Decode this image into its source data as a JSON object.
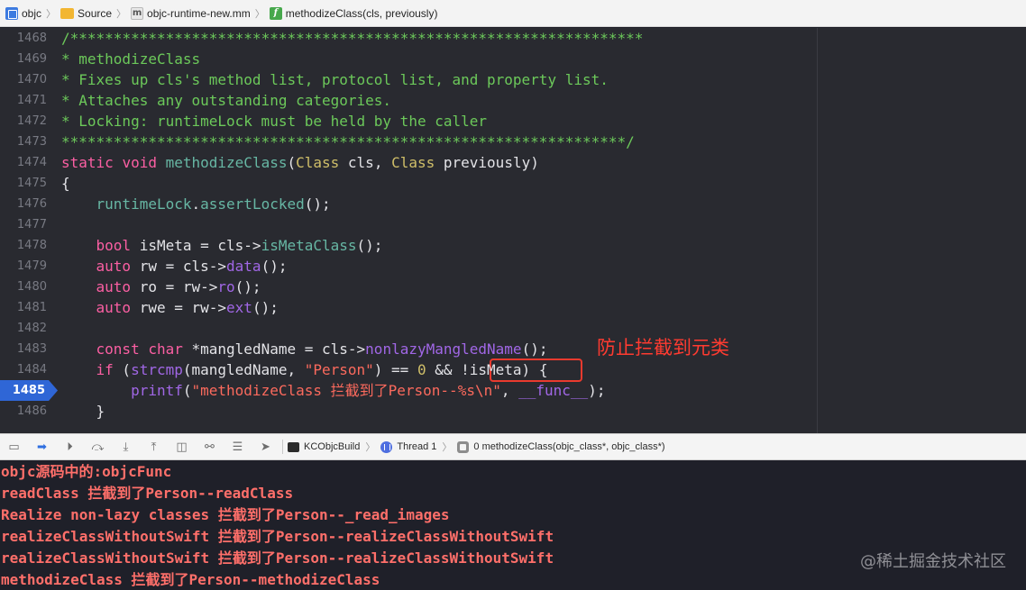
{
  "breadcrumb": [
    {
      "label": "objc",
      "icon": "project-icon"
    },
    {
      "label": "Source",
      "icon": "folder-icon"
    },
    {
      "label": "objc-runtime-new.mm",
      "icon": "objc-file-icon"
    },
    {
      "label": "methodizeClass(cls, previously)",
      "icon": "function-icon"
    }
  ],
  "editor": {
    "current_line": "1485",
    "annotation": "防止拦截到元类",
    "line_numbers": [
      "1468",
      "1469",
      "1470",
      "1471",
      "1472",
      "1473",
      "1474",
      "1475",
      "1476",
      "1477",
      "1478",
      "1479",
      "1480",
      "1481",
      "1482",
      "1483",
      "1484",
      "1485",
      "1486"
    ],
    "lines": [
      [
        {
          "t": "/**",
          "c": "com"
        },
        {
          "t": "****************************************************************",
          "c": "com"
        }
      ],
      [
        {
          "t": "* methodizeClass",
          "c": "com"
        }
      ],
      [
        {
          "t": "* Fixes up cls's method list, protocol list, and property list.",
          "c": "com"
        }
      ],
      [
        {
          "t": "* Attaches any outstanding categories.",
          "c": "com"
        }
      ],
      [
        {
          "t": "* Locking: runtimeLock must be held by the caller",
          "c": "com"
        }
      ],
      [
        {
          "t": "*****************************************************************/",
          "c": "com"
        }
      ],
      [
        {
          "t": "static",
          "c": "kw"
        },
        {
          "t": " ",
          "c": "txt"
        },
        {
          "t": "void",
          "c": "kw"
        },
        {
          "t": " ",
          "c": "txt"
        },
        {
          "t": "methodizeClass",
          "c": "fn"
        },
        {
          "t": "(",
          "c": "txt"
        },
        {
          "t": "Class",
          "c": "num"
        },
        {
          "t": " cls, ",
          "c": "txt"
        },
        {
          "t": "Class",
          "c": "num"
        },
        {
          "t": " previously)",
          "c": "txt"
        }
      ],
      [
        {
          "t": "{",
          "c": "txt"
        }
      ],
      [
        {
          "t": "    ",
          "c": "txt"
        },
        {
          "t": "runtimeLock",
          "c": "fn"
        },
        {
          "t": ".",
          "c": "txt"
        },
        {
          "t": "assertLocked",
          "c": "fn"
        },
        {
          "t": "();",
          "c": "txt"
        }
      ],
      [
        {
          "t": "",
          "c": "txt"
        }
      ],
      [
        {
          "t": "    ",
          "c": "txt"
        },
        {
          "t": "bool",
          "c": "kw"
        },
        {
          "t": " isMeta = cls->",
          "c": "txt"
        },
        {
          "t": "isMetaClass",
          "c": "fn"
        },
        {
          "t": "();",
          "c": "txt"
        }
      ],
      [
        {
          "t": "    ",
          "c": "txt"
        },
        {
          "t": "auto",
          "c": "kw"
        },
        {
          "t": " rw = cls->",
          "c": "txt"
        },
        {
          "t": "data",
          "c": "call"
        },
        {
          "t": "();",
          "c": "txt"
        }
      ],
      [
        {
          "t": "    ",
          "c": "txt"
        },
        {
          "t": "auto",
          "c": "kw"
        },
        {
          "t": " ro = rw->",
          "c": "txt"
        },
        {
          "t": "ro",
          "c": "call"
        },
        {
          "t": "();",
          "c": "txt"
        }
      ],
      [
        {
          "t": "    ",
          "c": "txt"
        },
        {
          "t": "auto",
          "c": "kw"
        },
        {
          "t": " rwe = rw->",
          "c": "txt"
        },
        {
          "t": "ext",
          "c": "call"
        },
        {
          "t": "();",
          "c": "txt"
        }
      ],
      [
        {
          "t": "",
          "c": "txt"
        }
      ],
      [
        {
          "t": "    ",
          "c": "txt"
        },
        {
          "t": "const",
          "c": "kw"
        },
        {
          "t": " ",
          "c": "txt"
        },
        {
          "t": "char",
          "c": "kw"
        },
        {
          "t": " *mangledName = cls->",
          "c": "txt"
        },
        {
          "t": "nonlazyMangledName",
          "c": "call"
        },
        {
          "t": "();",
          "c": "txt"
        }
      ],
      [
        {
          "t": "    ",
          "c": "txt"
        },
        {
          "t": "if",
          "c": "kw"
        },
        {
          "t": " (",
          "c": "txt"
        },
        {
          "t": "strcmp",
          "c": "call"
        },
        {
          "t": "(mangledName, ",
          "c": "txt"
        },
        {
          "t": "\"Person\"",
          "c": "str"
        },
        {
          "t": ") == ",
          "c": "txt"
        },
        {
          "t": "0",
          "c": "num"
        },
        {
          "t": " && !isMeta) {",
          "c": "txt"
        }
      ],
      [
        {
          "t": "        ",
          "c": "txt"
        },
        {
          "t": "printf",
          "c": "call"
        },
        {
          "t": "(",
          "c": "txt"
        },
        {
          "t": "\"methodizeClass 拦截到了Person--%s\\n\"",
          "c": "str"
        },
        {
          "t": ", ",
          "c": "txt"
        },
        {
          "t": "__func__",
          "c": "call"
        },
        {
          "t": ");",
          "c": "txt"
        }
      ],
      [
        {
          "t": "    }",
          "c": "txt"
        }
      ]
    ]
  },
  "debugbar": {
    "target": "KCObjcBuild",
    "thread": "Thread 1",
    "frame": "0 methodizeClass(objc_class*, objc_class*)",
    "buttons": [
      "hide-debug-area",
      "toggle-breakpoints",
      "continue",
      "step-over",
      "step-into",
      "step-out",
      "debug-view-hierarchy",
      "memory-graph",
      "environment-overrides",
      "simulate-location"
    ]
  },
  "console": {
    "lines": [
      "objc源码中的:objcFunc",
      "readClass 拦截到了Person--readClass",
      "Realize non-lazy classes 拦截到了Person--_read_images",
      "realizeClassWithoutSwift 拦截到了Person--realizeClassWithoutSwift",
      "realizeClassWithoutSwift 拦截到了Person--realizeClassWithoutSwift",
      "methodizeClass 拦截到了Person--methodizeClass"
    ]
  },
  "watermark": "@稀土掘金技术社区"
}
